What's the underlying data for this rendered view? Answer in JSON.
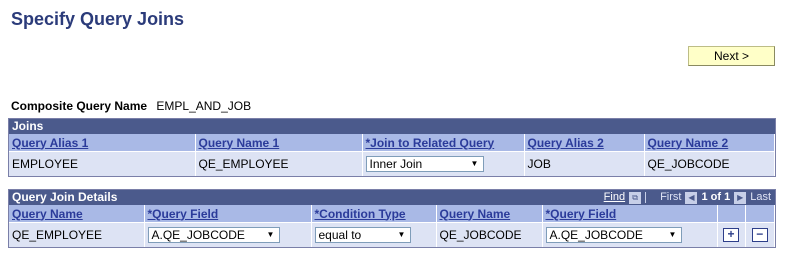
{
  "page": {
    "title": "Specify Query Joins"
  },
  "toolbar": {
    "next_label": "Next >"
  },
  "composite": {
    "label": "Composite Query Name",
    "value": "EMPL_AND_JOB"
  },
  "joins": {
    "title": "Joins",
    "headers": [
      "Query Alias 1",
      "Query Name 1",
      "*Join to Related Query",
      "Query Alias 2",
      "Query Name 2"
    ],
    "row": {
      "alias1": "EMPLOYEE",
      "name1": "QE_EMPLOYEE",
      "join_type": "Inner Join",
      "alias2": "JOB",
      "name2": "QE_JOBCODE"
    }
  },
  "details": {
    "title": "Query Join Details",
    "nav": {
      "find": "Find",
      "first": "First",
      "count": "1 of 1",
      "last": "Last"
    },
    "headers": [
      "Query Name",
      "*Query Field",
      "*Condition Type",
      "Query Name",
      "*Query Field"
    ],
    "row": {
      "qname1": "QE_EMPLOYEE",
      "qfield1": "A.QE_JOBCODE",
      "condition": "equal to",
      "qname2": "QE_JOBCODE",
      "qfield2": "A.QE_JOBCODE"
    },
    "add_symbol": "+",
    "remove_symbol": "−"
  },
  "icons": {
    "dropdown": "chevron-down-icon",
    "view_all": "view-all-icon",
    "first": "arrow-left-icon",
    "last": "arrow-right-icon"
  }
}
